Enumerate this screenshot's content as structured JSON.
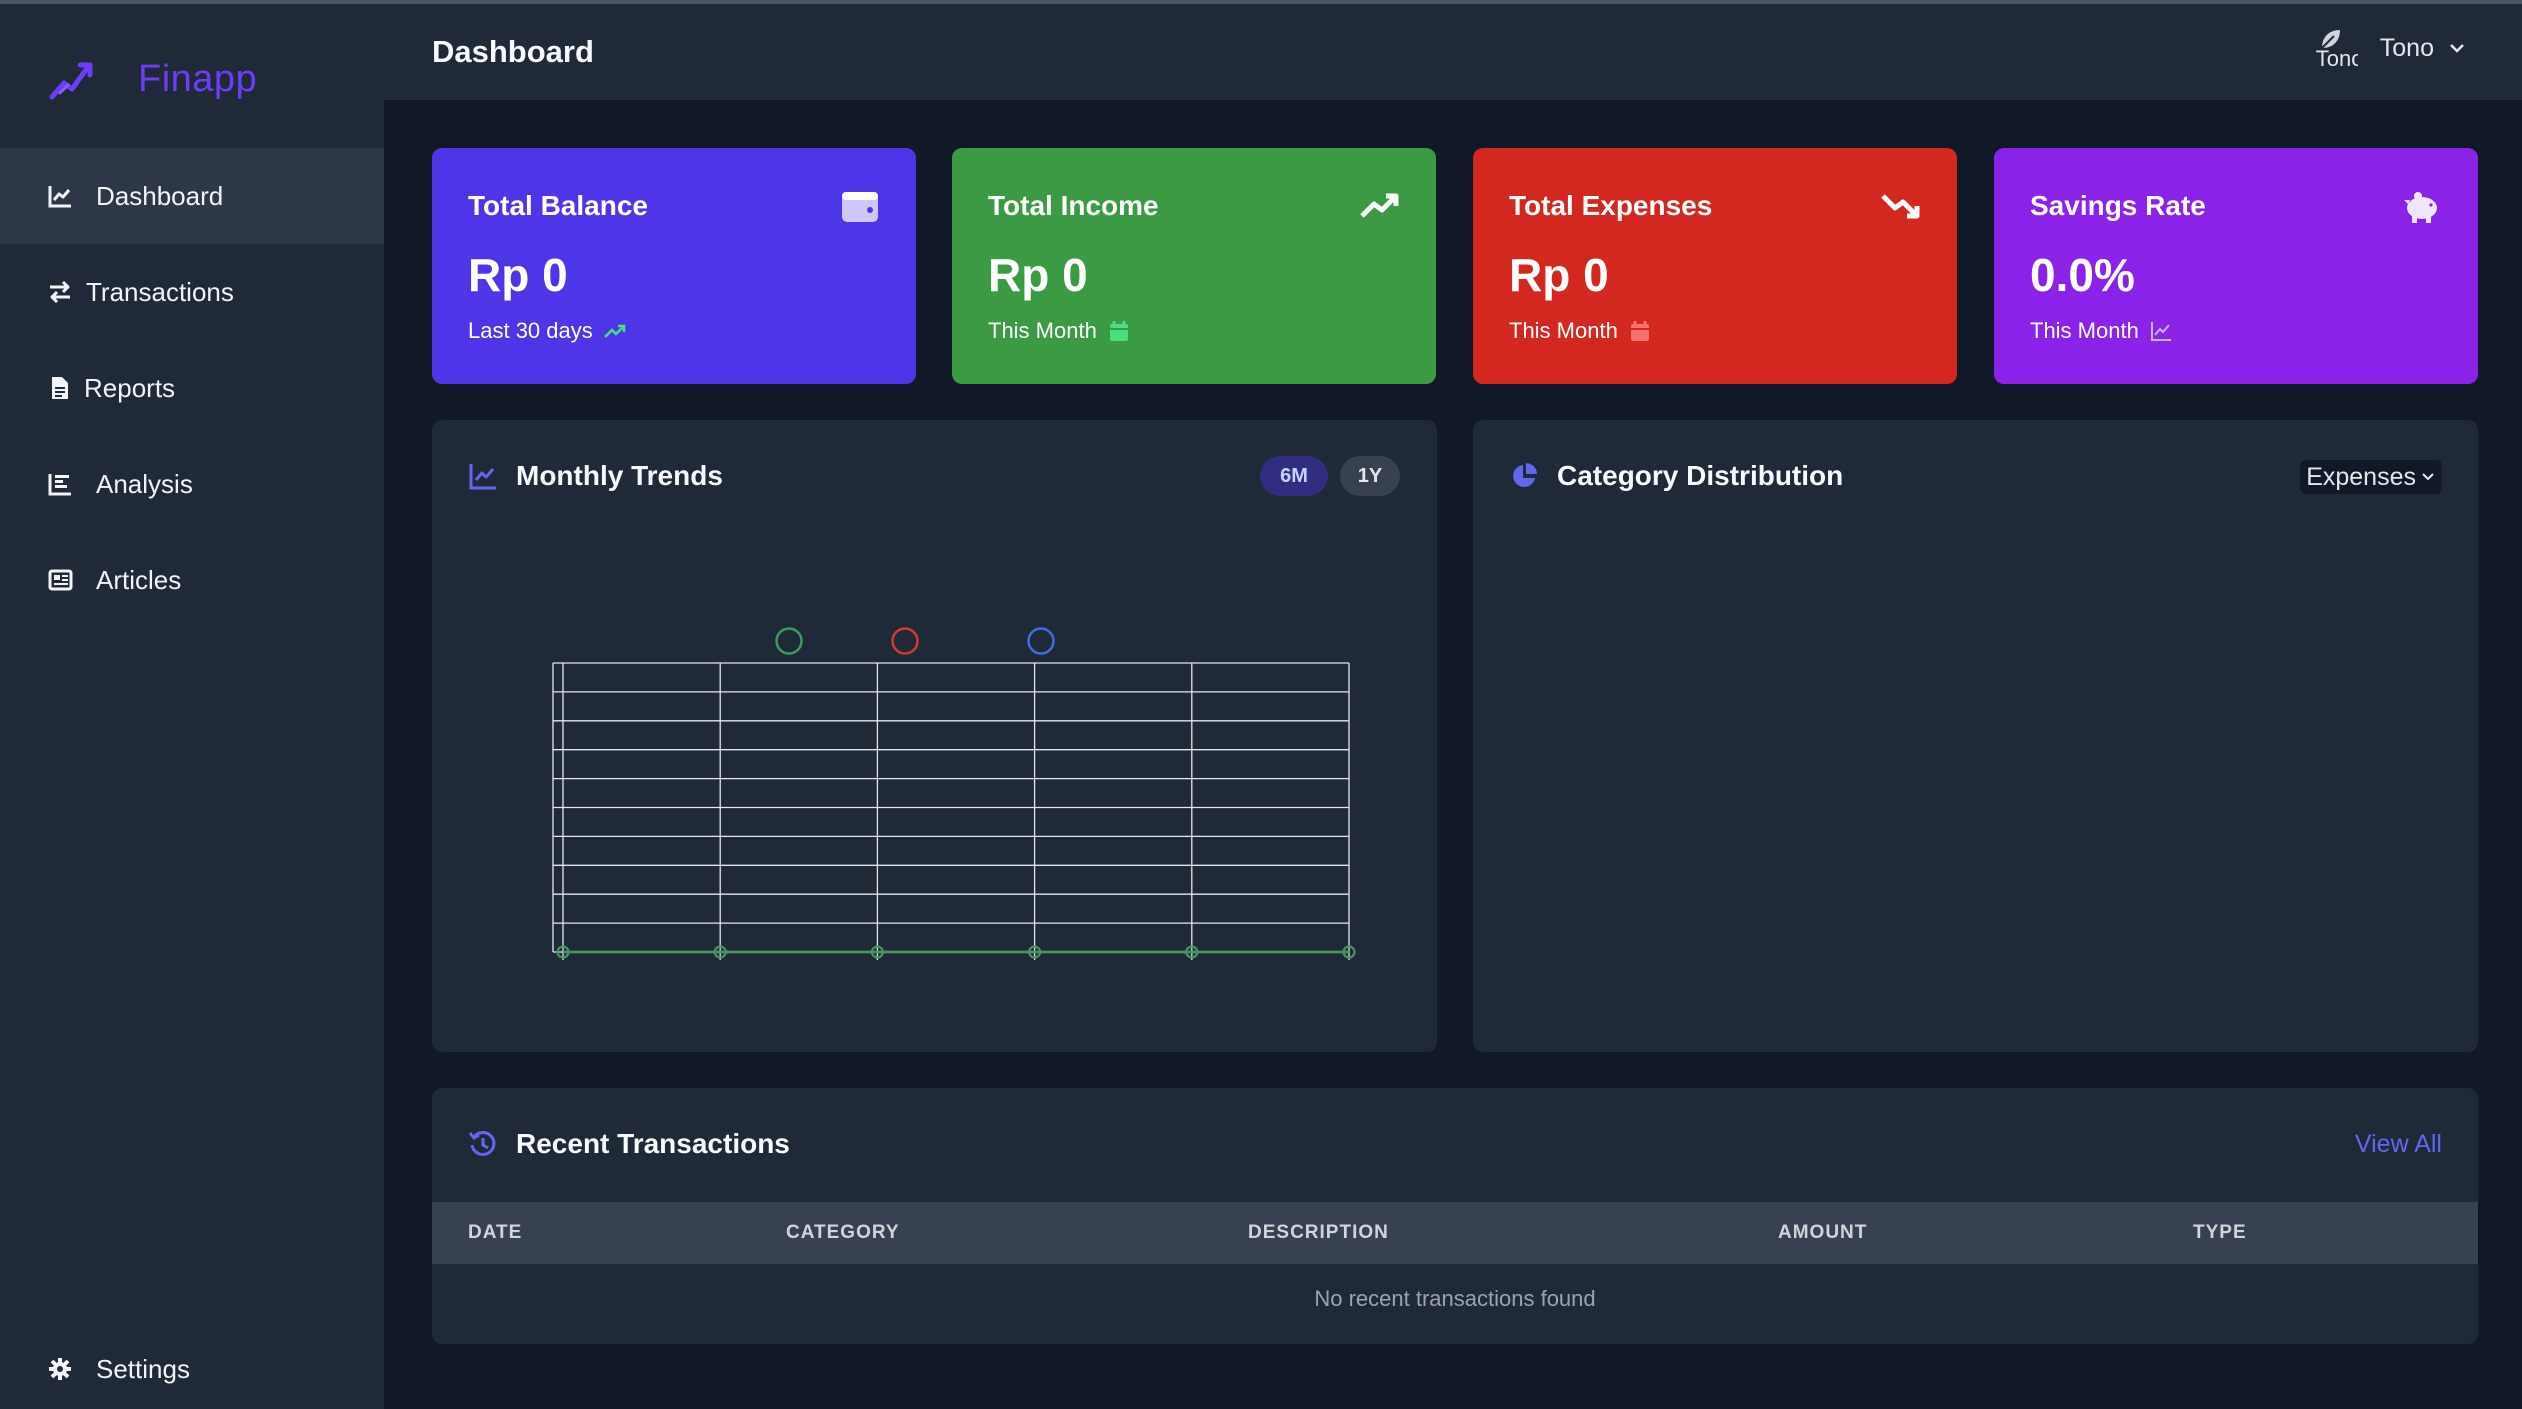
{
  "brand": {
    "name": "Finapp",
    "logo_icon": "chart-line-up-icon"
  },
  "sidebar": {
    "items": [
      {
        "label": "Dashboard",
        "icon": "chart-line-icon",
        "active": true
      },
      {
        "label": "Transactions",
        "icon": "exchange-icon",
        "active": false
      },
      {
        "label": "Reports",
        "icon": "file-icon",
        "active": false
      },
      {
        "label": "Analysis",
        "icon": "chart-bar-icon",
        "active": false
      },
      {
        "label": "Articles",
        "icon": "newspaper-icon",
        "active": false
      }
    ],
    "settings": {
      "label": "Settings",
      "icon": "gear-icon"
    }
  },
  "header": {
    "title": "Dashboard",
    "user": {
      "name": "Tono",
      "avatar_alt": "Tono"
    }
  },
  "stats": [
    {
      "title": "Total Balance",
      "value": "Rp 0",
      "sub": "Last 30 days",
      "icon": "wallet-icon",
      "sub_icon": "trend-up-icon",
      "color": "#4f35e8"
    },
    {
      "title": "Total Income",
      "value": "Rp 0",
      "sub": "This Month",
      "icon": "trend-up-icon",
      "sub_icon": "calendar-icon",
      "color": "#3c9a44"
    },
    {
      "title": "Total Expenses",
      "value": "Rp 0",
      "sub": "This Month",
      "icon": "trend-down-icon",
      "sub_icon": "calendar-icon",
      "color": "#d3281f"
    },
    {
      "title": "Savings Rate",
      "value": "0.0%",
      "sub": "This Month",
      "icon": "piggy-bank-icon",
      "sub_icon": "chart-line-icon",
      "color": "#8a22e8"
    }
  ],
  "monthly_trends": {
    "title": "Monthly Trends",
    "ranges": [
      "6M",
      "1Y"
    ],
    "active_range": "6M"
  },
  "category_distribution": {
    "title": "Category Distribution",
    "selected": "Expenses"
  },
  "recent_transactions": {
    "title": "Recent Transactions",
    "view_all": "View All",
    "columns": [
      "DATE",
      "CATEGORY",
      "DESCRIPTION",
      "AMOUNT",
      "TYPE"
    ],
    "empty_message": "No recent transactions found"
  },
  "chart_data": {
    "type": "line",
    "title": "",
    "xlabel": "",
    "ylabel": "",
    "categories": [
      "",
      "",
      "",
      "",
      "",
      ""
    ],
    "series": [
      {
        "color": "#3c9a5f",
        "values": [
          0,
          0,
          0,
          0,
          0,
          0
        ]
      },
      {
        "color": "#d33a2f",
        "values": [
          0,
          0,
          0,
          0,
          0,
          0
        ]
      },
      {
        "color": "#3b6fe0",
        "values": [
          0,
          0,
          0,
          0,
          0,
          0
        ]
      }
    ],
    "ylim": [
      0,
      10
    ],
    "grid": true,
    "legend": "top-center"
  }
}
